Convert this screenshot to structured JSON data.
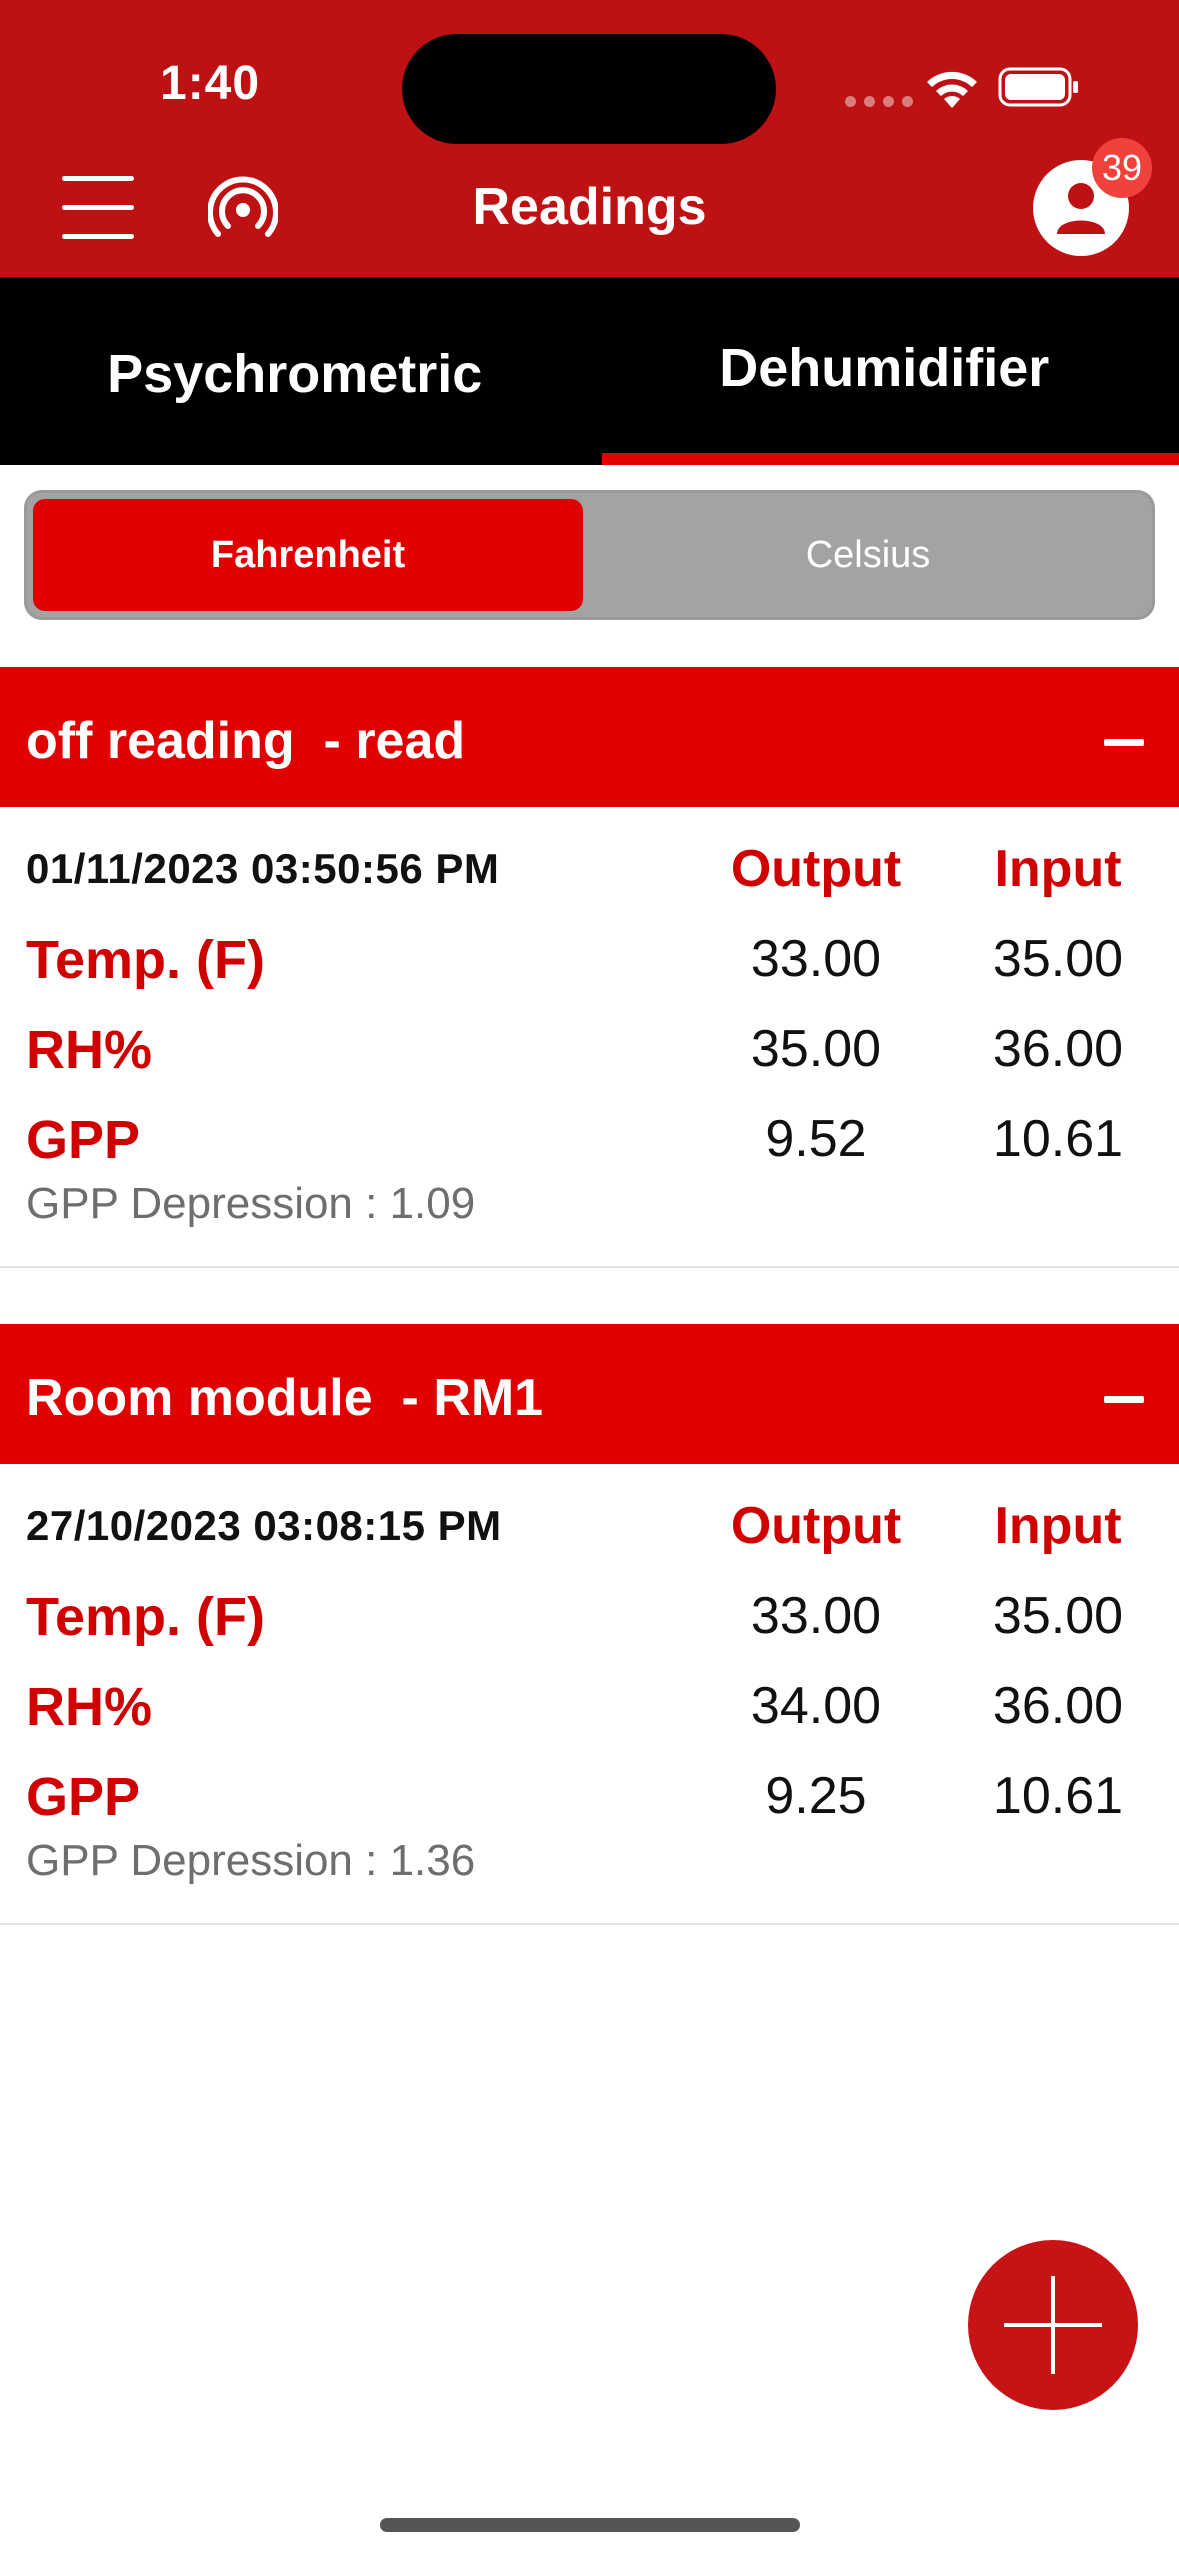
{
  "status_bar": {
    "time": "1:40"
  },
  "nav": {
    "title": "Readings",
    "badge_count": "39"
  },
  "tabs": [
    {
      "label": "Psychrometric",
      "selected": false
    },
    {
      "label": "Dehumidifier",
      "selected": true
    }
  ],
  "units": {
    "fahrenheit": "Fahrenheit",
    "celsius": "Celsius",
    "selected": "Fahrenheit"
  },
  "columns": {
    "output": "Output",
    "input": "Input"
  },
  "cards": [
    {
      "title": "off reading  - read",
      "timestamp": "01/11/2023 03:50:56 PM",
      "rows": [
        {
          "label": "Temp. (F)",
          "output": "33.00",
          "input": "35.00"
        },
        {
          "label": "RH%",
          "output": "35.00",
          "input": "36.00"
        },
        {
          "label": "GPP",
          "output": "9.52",
          "input": "10.61"
        }
      ],
      "gpp_depression": "GPP Depression : 1.09"
    },
    {
      "title": "Room module  - RM1",
      "timestamp": "27/10/2023 03:08:15 PM",
      "rows": [
        {
          "label": "Temp. (F)",
          "output": "33.00",
          "input": "35.00"
        },
        {
          "label": "RH%",
          "output": "34.00",
          "input": "36.00"
        },
        {
          "label": "GPP",
          "output": "9.25",
          "input": "10.61"
        }
      ],
      "gpp_depression": "GPP Depression : 1.36"
    }
  ],
  "colors": {
    "header": "#BE1113",
    "accent": "#E00000",
    "tabs_bg": "#000000"
  }
}
